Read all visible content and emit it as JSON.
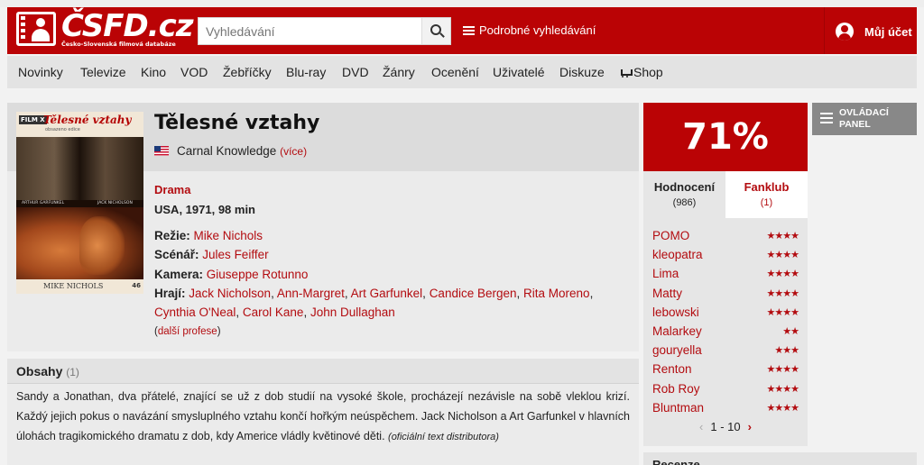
{
  "header": {
    "logo_text": "ČSFD.cz",
    "logo_subtitle": "Česko-Slovenská filmová databáze",
    "search_placeholder": "Vyhledávání",
    "advanced_search": "Podrobné vyhledávání",
    "account": "Můj účet"
  },
  "nav": {
    "items": [
      "Novinky",
      "Televize",
      "Kino",
      "VOD",
      "Žebříčky",
      "Blu-ray",
      "DVD",
      "Žánry",
      "Ocenění",
      "Uživatelé",
      "Diskuze",
      "Shop"
    ]
  },
  "film": {
    "title": "Tělesné vztahy",
    "original_title": "Carnal Knowledge",
    "original_more": "(více)",
    "genre": "Drama",
    "origin": "USA, 1971, 98 min",
    "director_label": "Režie:",
    "director": "Mike Nichols",
    "writer_label": "Scénář:",
    "writer": "Jules Feiffer",
    "camera_label": "Kamera:",
    "camera": "Giuseppe Rotunno",
    "cast_label": "Hrají:",
    "cast": [
      "Jack Nicholson",
      "Ann-Margret",
      "Art Garfunkel",
      "Candice Bergen",
      "Rita Moreno",
      "Cynthia O'Neal",
      "Carol Kane",
      "John Dullaghan"
    ],
    "more_professions_prefix": "(",
    "more_professions": "další profese",
    "more_professions_suffix": ")",
    "poster": {
      "label": "FILM X",
      "title": "Tělesné vztahy",
      "subtitle": "obsazeno edice",
      "actor_left": "ARTHUR GARFUNKEL",
      "actor_right": "JACK NICHOLSON",
      "director": "MIKE NICHOLS",
      "number": "46"
    }
  },
  "plot": {
    "title": "Obsahy",
    "count": "(1)",
    "text": "Sandy a Jonathan, dva přátelé, znající se už z dob studií na vysoké škole, procházejí nezávisle na sobě vleklou krizí. Každý jejich pokus o navázání smysluplného vztahu končí hořkým neúspěchem. Jack Nicholson a Art Garfunkel v hlavních úlohách tragikomického dramatu z dob, kdy Americe vládly květinové děti.",
    "note": "(oficiální text distributora)"
  },
  "rating": {
    "score": "71%",
    "tab_ratings": "Hodnocení",
    "tab_ratings_count": "(986)",
    "tab_fanclub": "Fanklub",
    "tab_fanclub_count": "(1)",
    "users": [
      {
        "name": "POMO",
        "stars": 4
      },
      {
        "name": "kleopatra",
        "stars": 4
      },
      {
        "name": "Lima",
        "stars": 4
      },
      {
        "name": "Matty",
        "stars": 4
      },
      {
        "name": "lebowski",
        "stars": 4
      },
      {
        "name": "Malarkey",
        "stars": 2
      },
      {
        "name": "gouryella",
        "stars": 3
      },
      {
        "name": "Renton",
        "stars": 4
      },
      {
        "name": "Rob Roy",
        "stars": 4
      },
      {
        "name": "Bluntman",
        "stars": 4
      }
    ],
    "pager": "1 - 10"
  },
  "panel_button": "OVLÁDACÍ PANEL",
  "next_section": "Recenze",
  "colors": {
    "brand": "#ba0305",
    "link": "#b30c10"
  }
}
